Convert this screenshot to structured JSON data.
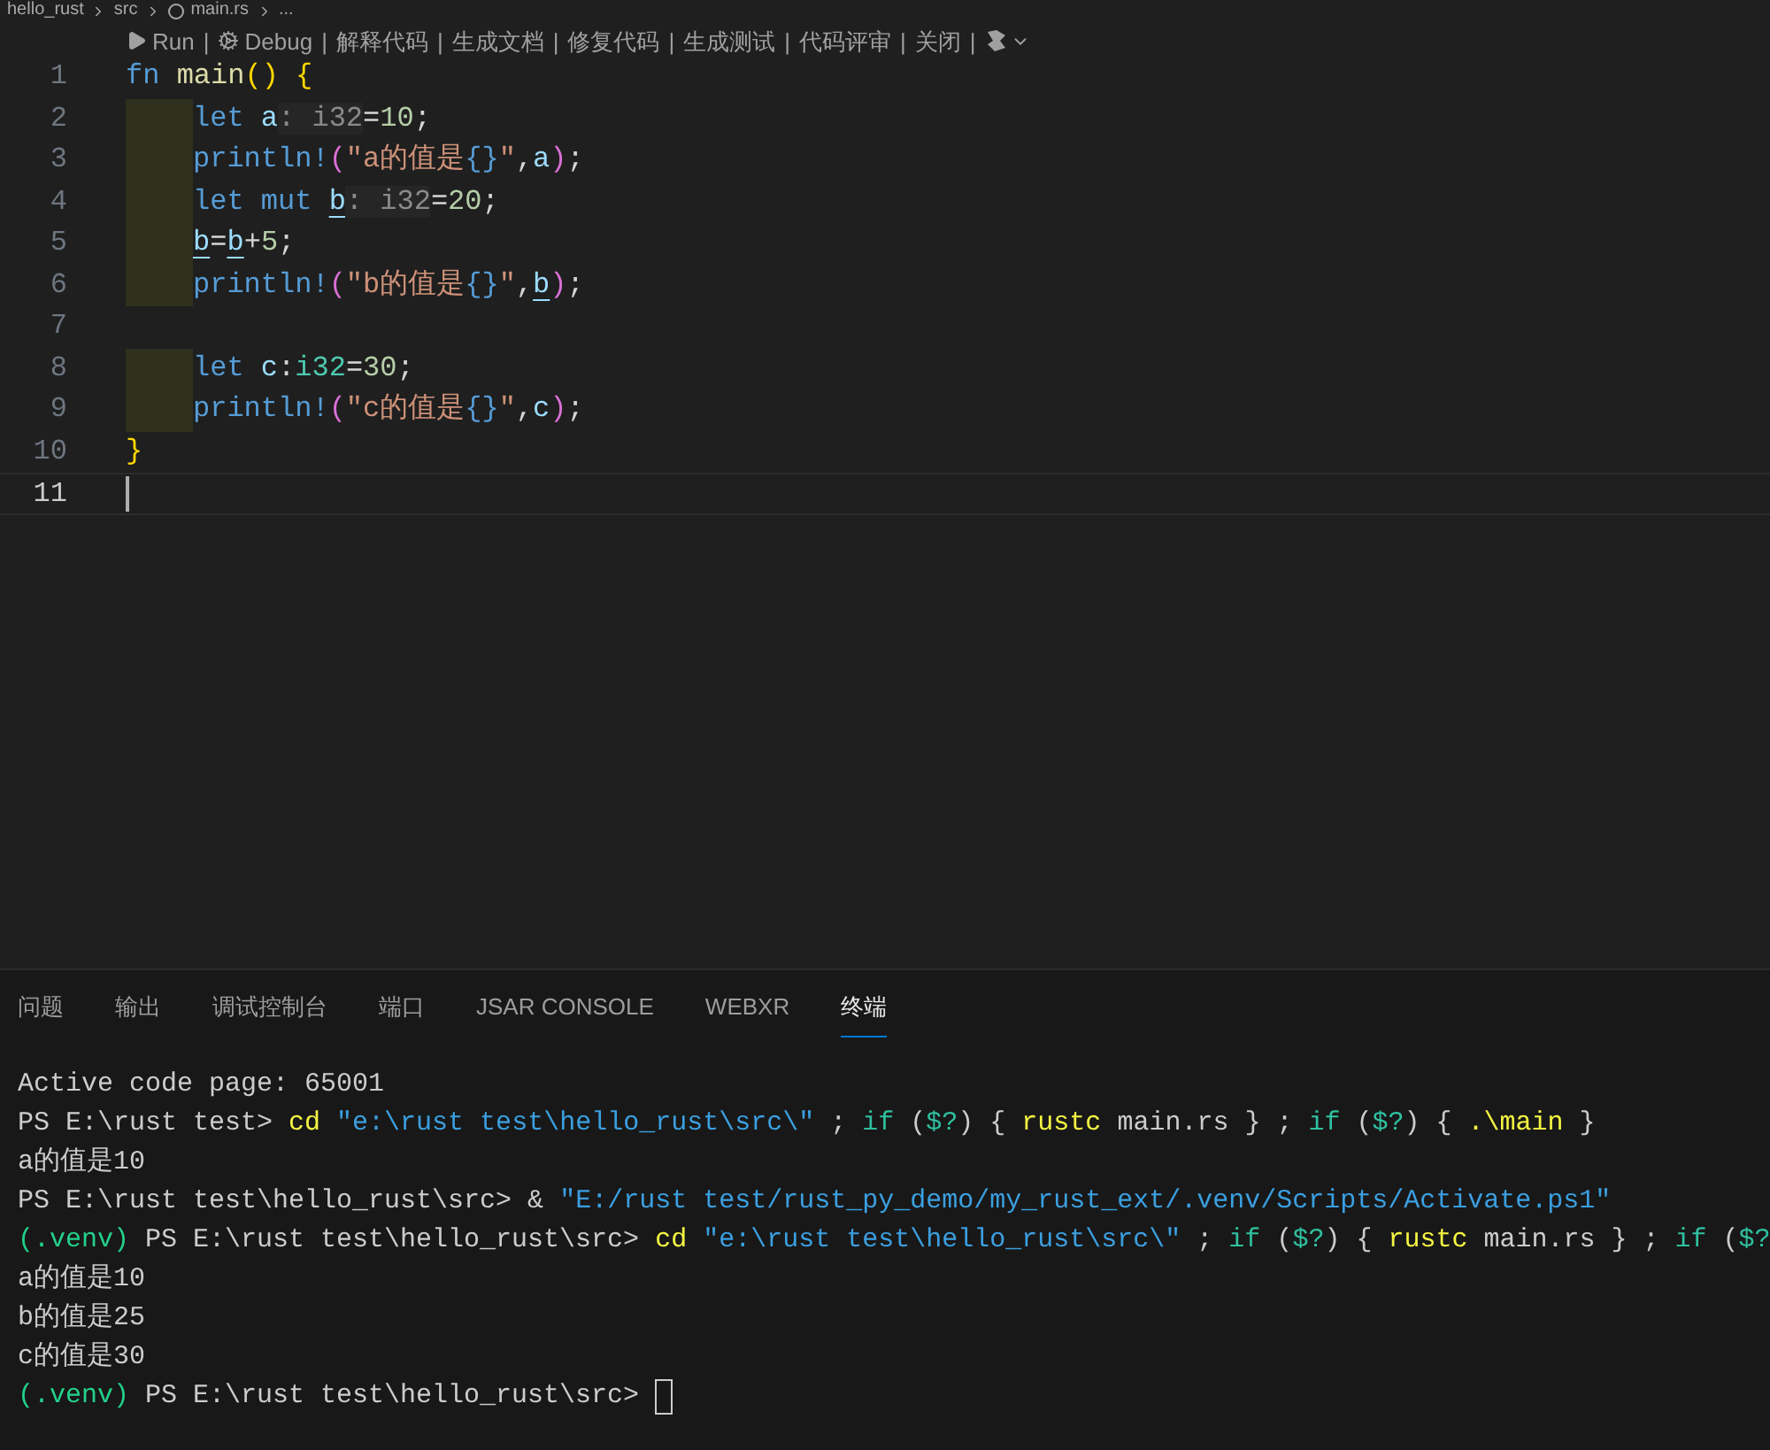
{
  "breadcrumb": [
    "hello_rust",
    "src",
    "main.rs",
    "..."
  ],
  "codelens": {
    "separator": "|",
    "items": [
      {
        "kind": "run",
        "label": "Run"
      },
      {
        "kind": "debug",
        "label": "Debug"
      },
      {
        "kind": "text",
        "label": "解释代码"
      },
      {
        "kind": "text",
        "label": "生成文档"
      },
      {
        "kind": "text",
        "label": "修复代码"
      },
      {
        "kind": "text",
        "label": "生成测试"
      },
      {
        "kind": "text",
        "label": "代码评审"
      },
      {
        "kind": "text",
        "label": "关闭"
      },
      {
        "kind": "menu"
      }
    ]
  },
  "editor": {
    "lines": [
      {
        "number": "1",
        "indented": false,
        "current": false,
        "tokens": [
          {
            "text": "fn ",
            "kind": "keyword"
          },
          {
            "text": "main",
            "kind": "function"
          },
          {
            "text": "() {",
            "kind": "bracket1"
          }
        ]
      },
      {
        "number": "2",
        "indented": true,
        "current": false,
        "tokens": [
          {
            "text": "let ",
            "kind": "keyword"
          },
          {
            "text": "a",
            "kind": "variable"
          },
          {
            "text": ": i32",
            "kind": "inlay"
          },
          {
            "text": "=",
            "kind": "punct"
          },
          {
            "text": "10",
            "kind": "number"
          },
          {
            "text": ";",
            "kind": "punct"
          }
        ]
      },
      {
        "number": "3",
        "indented": true,
        "current": false,
        "tokens": [
          {
            "text": "println!",
            "kind": "macro"
          },
          {
            "text": "(",
            "kind": "bracket2"
          },
          {
            "text": "\"a的值是",
            "kind": "string"
          },
          {
            "text": "{}",
            "kind": "placeholder"
          },
          {
            "text": "\"",
            "kind": "string"
          },
          {
            "text": ",",
            "kind": "punct"
          },
          {
            "text": "a",
            "kind": "variable"
          },
          {
            "text": ")",
            "kind": "bracket2"
          },
          {
            "text": ";",
            "kind": "punct"
          }
        ]
      },
      {
        "number": "4",
        "indented": true,
        "current": false,
        "tokens": [
          {
            "text": "let mut ",
            "kind": "keyword"
          },
          {
            "text": "b",
            "kind": "variable",
            "underline": true
          },
          {
            "text": ": i32",
            "kind": "inlay"
          },
          {
            "text": "=",
            "kind": "punct"
          },
          {
            "text": "20",
            "kind": "number"
          },
          {
            "text": ";",
            "kind": "punct"
          }
        ]
      },
      {
        "number": "5",
        "indented": true,
        "current": false,
        "tokens": [
          {
            "text": "b",
            "kind": "variable",
            "underline": true
          },
          {
            "text": "=",
            "kind": "punct"
          },
          {
            "text": "b",
            "kind": "variable",
            "underline": true
          },
          {
            "text": "+",
            "kind": "punct"
          },
          {
            "text": "5",
            "kind": "number"
          },
          {
            "text": ";",
            "kind": "punct"
          }
        ]
      },
      {
        "number": "6",
        "indented": true,
        "current": false,
        "tokens": [
          {
            "text": "println!",
            "kind": "macro"
          },
          {
            "text": "(",
            "kind": "bracket2"
          },
          {
            "text": "\"b的值是",
            "kind": "string"
          },
          {
            "text": "{}",
            "kind": "placeholder"
          },
          {
            "text": "\"",
            "kind": "string"
          },
          {
            "text": ",",
            "kind": "punct"
          },
          {
            "text": "b",
            "kind": "variable",
            "underline": true
          },
          {
            "text": ")",
            "kind": "bracket2"
          },
          {
            "text": ";",
            "kind": "punct"
          }
        ]
      },
      {
        "number": "7",
        "indented": false,
        "current": false
      },
      {
        "number": "8",
        "indented": true,
        "current": false,
        "tokens": [
          {
            "text": "let ",
            "kind": "keyword"
          },
          {
            "text": "c",
            "kind": "variable"
          },
          {
            "text": ":",
            "kind": "punct"
          },
          {
            "text": "i32",
            "kind": "type"
          },
          {
            "text": "=",
            "kind": "punct"
          },
          {
            "text": "30",
            "kind": "number"
          },
          {
            "text": ";",
            "kind": "punct"
          }
        ]
      },
      {
        "number": "9",
        "indented": true,
        "current": false,
        "tokens": [
          {
            "text": "println!",
            "kind": "macro"
          },
          {
            "text": "(",
            "kind": "bracket2"
          },
          {
            "text": "\"c的值是",
            "kind": "string"
          },
          {
            "text": "{}",
            "kind": "placeholder"
          },
          {
            "text": "\"",
            "kind": "string"
          },
          {
            "text": ",",
            "kind": "punct"
          },
          {
            "text": "c",
            "kind": "variable"
          },
          {
            "text": ")",
            "kind": "bracket2"
          },
          {
            "text": ";",
            "kind": "punct"
          }
        ]
      },
      {
        "number": "10",
        "indented": false,
        "current": false,
        "tokens": [
          {
            "text": "}",
            "kind": "bracket1"
          }
        ]
      },
      {
        "number": "11",
        "indented": false,
        "current": true
      }
    ]
  },
  "panel": {
    "tabs": [
      {
        "label": "问题",
        "selected": false
      },
      {
        "label": "输出",
        "selected": false
      },
      {
        "label": "调试控制台",
        "selected": false
      },
      {
        "label": "端口",
        "selected": false
      },
      {
        "label": "JSAR CONSOLE",
        "selected": false
      },
      {
        "label": "WEBXR",
        "selected": false
      },
      {
        "label": "终端",
        "selected": true
      }
    ],
    "terminal": {
      "cursor": true,
      "lines": [
        [
          {
            "text": "Active code page: 65001",
            "kind": "plain"
          }
        ],
        [
          {
            "text": "PS E:\\rust test> ",
            "kind": "plain"
          },
          {
            "text": "cd ",
            "kind": "command"
          },
          {
            "text": "\"e:\\rust test\\hello_rust\\src\\\"",
            "kind": "string"
          },
          {
            "text": " ; ",
            "kind": "plain"
          },
          {
            "text": "if",
            "kind": "keyword"
          },
          {
            "text": " (",
            "kind": "plain"
          },
          {
            "text": "$?",
            "kind": "keyword"
          },
          {
            "text": ") { ",
            "kind": "plain"
          },
          {
            "text": "rustc",
            "kind": "command"
          },
          {
            "text": " main.rs } ; ",
            "kind": "plain"
          },
          {
            "text": "if",
            "kind": "keyword"
          },
          {
            "text": " (",
            "kind": "plain"
          },
          {
            "text": "$?",
            "kind": "keyword"
          },
          {
            "text": ") { ",
            "kind": "plain"
          },
          {
            "text": ".\\main",
            "kind": "command"
          },
          {
            "text": " }",
            "kind": "plain"
          }
        ],
        [
          {
            "text": "a的值是10",
            "kind": "plain"
          }
        ],
        [
          {
            "text": "PS E:\\rust test\\hello_rust\\src> & ",
            "kind": "plain"
          },
          {
            "text": "\"E:/rust test/rust_py_demo/my_rust_ext/.venv/Scripts/Activate.ps1\"",
            "kind": "string"
          }
        ],
        [
          {
            "text": "(.venv)",
            "kind": "venv"
          },
          {
            "text": " PS E:\\rust test\\hello_rust\\src> ",
            "kind": "plain"
          },
          {
            "text": "cd ",
            "kind": "command"
          },
          {
            "text": "\"e:\\rust test\\hello_rust\\src\\\"",
            "kind": "string"
          },
          {
            "text": " ; ",
            "kind": "plain"
          },
          {
            "text": "if",
            "kind": "keyword"
          },
          {
            "text": " (",
            "kind": "plain"
          },
          {
            "text": "$?",
            "kind": "keyword"
          },
          {
            "text": ") { ",
            "kind": "plain"
          },
          {
            "text": "rustc",
            "kind": "command"
          },
          {
            "text": " main.rs } ; ",
            "kind": "plain"
          },
          {
            "text": "if",
            "kind": "keyword"
          },
          {
            "text": " (",
            "kind": "plain"
          },
          {
            "text": "$?",
            "kind": "keyword"
          }
        ],
        [
          {
            "text": "a的值是10",
            "kind": "plain"
          }
        ],
        [
          {
            "text": "b的值是25",
            "kind": "plain"
          }
        ],
        [
          {
            "text": "c的值是30",
            "kind": "plain"
          }
        ],
        [
          {
            "text": "(.venv)",
            "kind": "venv"
          },
          {
            "text": " PS E:\\rust test\\hello_rust\\src> ",
            "kind": "plain"
          }
        ]
      ]
    }
  }
}
